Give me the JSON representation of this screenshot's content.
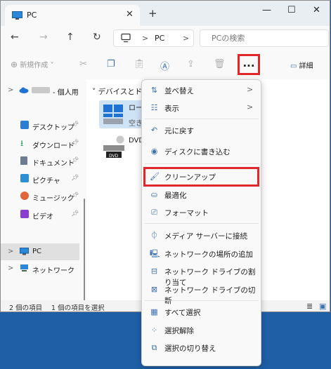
{
  "window": {
    "tab_title": "PC",
    "tab_close": "✕",
    "new_tab": "+",
    "minimize": "—",
    "maximize": "☐",
    "close": "✕"
  },
  "nav": {
    "back": "←",
    "forward": "→",
    "up": "↑",
    "refresh": "↻",
    "breadcrumb": [
      "PC"
    ],
    "search_placeholder": "PCの検索"
  },
  "toolbar": {
    "new_label": "新規作成",
    "more_label": "...",
    "details_label": "詳細"
  },
  "sidebar": {
    "onedrive_label": "- 個人用",
    "quick_access": [
      {
        "label": "デスクトップ",
        "icon": "desktop-icon",
        "color": "#2a7fd4"
      },
      {
        "label": "ダウンロード",
        "icon": "download-icon",
        "color": "#1f9d55"
      },
      {
        "label": "ドキュメント",
        "icon": "document-icon",
        "color": "#6b7c93"
      },
      {
        "label": "ピクチャ",
        "icon": "pictures-icon",
        "color": "#2b8fd8"
      },
      {
        "label": "ミュージック",
        "icon": "music-icon",
        "color": "#e0663a"
      },
      {
        "label": "ビデオ",
        "icon": "video-icon",
        "color": "#8a3fd1"
      }
    ],
    "pc_label": "PC",
    "network_label": "ネットワーク"
  },
  "main": {
    "group_header": "デバイスとドラ",
    "drive_label": "ロー",
    "drive_sub": "空き",
    "dvd_label": "DVD",
    "dvd_badge": "DVD"
  },
  "status": {
    "items": "2 個の項目",
    "selected": "1 個の項目を選択"
  },
  "context_menu": {
    "items": [
      {
        "label": "並べ替え",
        "icon": "sort-icon",
        "submenu": true
      },
      {
        "label": "表示",
        "icon": "view-icon",
        "submenu": true
      },
      {
        "label": "元に戻す",
        "icon": "undo-icon"
      },
      {
        "label": "ディスクに書き込む",
        "icon": "burn-disc-icon"
      },
      {
        "label": "クリーンアップ",
        "icon": "cleanup-brush-icon"
      },
      {
        "label": "最適化",
        "icon": "optimize-icon"
      },
      {
        "label": "フォーマット",
        "icon": "format-icon"
      },
      {
        "label": "メディア サーバーに接続",
        "icon": "media-server-icon"
      },
      {
        "label": "ネットワークの場所の追加",
        "icon": "network-location-icon"
      },
      {
        "label": "ネットワーク ドライブの割り当て",
        "icon": "map-drive-icon"
      },
      {
        "label": "ネットワーク ドライブの切断",
        "icon": "disconnect-drive-icon"
      },
      {
        "label": "すべて選択",
        "icon": "select-all-icon"
      },
      {
        "label": "選択解除",
        "icon": "select-none-icon"
      },
      {
        "label": "選択の切り替え",
        "icon": "invert-selection-icon"
      }
    ]
  },
  "colors": {
    "highlight": "#e0282c",
    "desktop_bg": "#1f5fa6",
    "accent": "#3b6fb0"
  }
}
